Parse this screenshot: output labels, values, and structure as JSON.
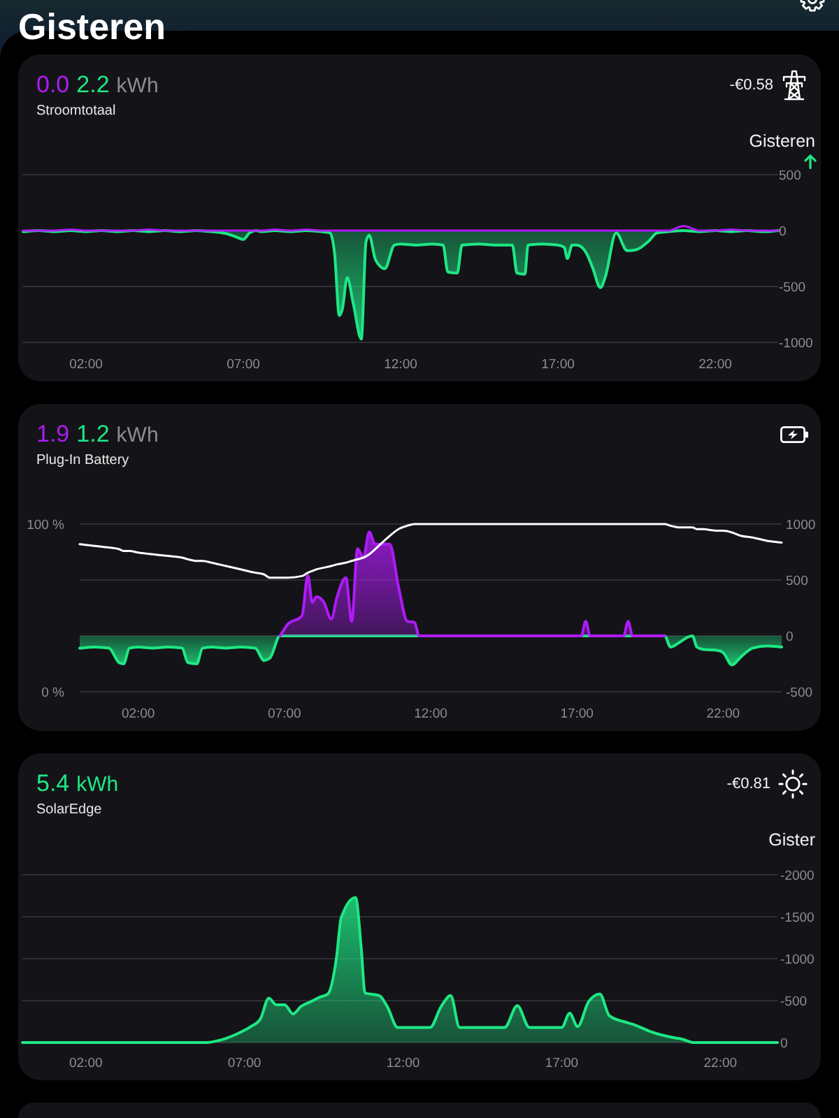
{
  "header": {
    "title": "Gisteren"
  },
  "cards": [
    {
      "kind": "grid",
      "readings": [
        {
          "value": "0.0",
          "color": "#ae1bf5"
        },
        {
          "value": "2.2",
          "color": "#1ee884"
        }
      ],
      "unit": "kWh",
      "name": "Stroomtotaal",
      "price": "-€0.58",
      "period": "Gisteren",
      "trend_up": true,
      "chart_data": {
        "type": "area",
        "grid": true,
        "x": [
          0,
          0.5,
          1,
          1.5,
          2,
          2.5,
          3,
          3.5,
          4,
          4.5,
          5,
          5.5,
          6,
          6.5,
          6.8,
          7,
          7.2,
          7.4,
          7.6,
          8,
          8.5,
          9,
          9.5,
          9.75,
          9.9,
          10.05,
          10.15,
          10.3,
          10.5,
          10.75,
          10.9,
          11,
          11.2,
          11.5,
          11.8,
          12,
          12.5,
          13,
          13.35,
          13.5,
          13.8,
          13.95,
          14.5,
          15,
          15.55,
          15.7,
          15.95,
          16.05,
          16.5,
          17,
          17.2,
          17.3,
          17.45,
          17.6,
          17.9,
          18.1,
          18.35,
          18.5,
          18.85,
          19.2,
          19.5,
          19.9,
          20.15,
          20.5,
          21,
          21.5,
          22,
          22.5,
          23,
          23.5,
          24
        ],
        "xlim": [
          0,
          24
        ],
        "xticks": [
          {
            "value": 2,
            "label": "02:00"
          },
          {
            "value": 7,
            "label": "07:00"
          },
          {
            "value": 12,
            "label": "12:00"
          },
          {
            "value": 17,
            "label": "17:00"
          },
          {
            "value": 22,
            "label": "22:00"
          }
        ],
        "ylim": [
          -1000,
          500
        ],
        "yticks": [
          500,
          0,
          -500,
          -1000
        ],
        "series": [
          {
            "color": "#1ee884",
            "values": [
              -10,
              0,
              -10,
              0,
              -10,
              0,
              -10,
              0,
              -10,
              0,
              -10,
              0,
              -10,
              -30,
              -60,
              -80,
              -20,
              0,
              -10,
              0,
              -10,
              0,
              -10,
              -20,
              -200,
              -760,
              -700,
              -420,
              -660,
              -970,
              -100,
              -40,
              -260,
              -340,
              -130,
              -120,
              -130,
              -120,
              -130,
              -370,
              -380,
              -130,
              -120,
              -130,
              -130,
              -380,
              -390,
              -130,
              -120,
              -130,
              -150,
              -250,
              -130,
              -130,
              -200,
              -330,
              -510,
              -420,
              -20,
              -180,
              -170,
              -90,
              -20,
              -10,
              0,
              -10,
              0,
              -10,
              0,
              -10,
              0
            ]
          },
          {
            "type": "line",
            "color": "#ae1bf5",
            "values": [
              0,
              0,
              0,
              10,
              0,
              0,
              0,
              0,
              10,
              0,
              0,
              0,
              0,
              0,
              0,
              0,
              0,
              0,
              0,
              10,
              0,
              10,
              0,
              0,
              0,
              0,
              0,
              0,
              0,
              0,
              0,
              0,
              0,
              0,
              0,
              0,
              0,
              0,
              0,
              0,
              0,
              0,
              0,
              0,
              0,
              0,
              0,
              0,
              0,
              0,
              0,
              0,
              0,
              0,
              0,
              0,
              0,
              0,
              0,
              0,
              0,
              0,
              0,
              0,
              40,
              0,
              0,
              10,
              0,
              0,
              0
            ]
          }
        ]
      }
    },
    {
      "kind": "battery",
      "readings": [
        {
          "value": "1.9",
          "color": "#ae1bf5"
        },
        {
          "value": "1.2",
          "color": "#1ee884"
        }
      ],
      "unit": "kWh",
      "name": "Plug-In Battery",
      "chart_data": {
        "type": "area",
        "grid": true,
        "x": [
          0,
          0.5,
          1,
          1.35,
          1.5,
          1.7,
          2,
          2.5,
          3,
          3.5,
          3.7,
          4,
          4.2,
          4.5,
          5,
          5.5,
          6,
          6.3,
          6.5,
          6.85,
          7.1,
          7.6,
          7.8,
          7.95,
          8.1,
          8.35,
          8.6,
          8.8,
          9.1,
          9.3,
          9.5,
          9.7,
          9.9,
          10.1,
          10.6,
          10.9,
          11.2,
          11.45,
          11.6,
          12,
          13,
          14,
          15,
          16,
          17,
          17.15,
          17.3,
          17.45,
          18,
          18.6,
          18.75,
          18.9,
          19.5,
          20,
          20.2,
          20.5,
          20.8,
          20.95,
          21.1,
          21.3,
          21.8,
          22,
          22.3,
          22.6,
          23,
          23.5,
          24
        ],
        "xlim": [
          0,
          24
        ],
        "xticks": [
          {
            "value": 2,
            "label": "02:00"
          },
          {
            "value": 7,
            "label": "07:00"
          },
          {
            "value": 12,
            "label": "12:00"
          },
          {
            "value": 17,
            "label": "17:00"
          },
          {
            "value": 22,
            "label": "22:00"
          }
        ],
        "ylim": [
          -500,
          1000
        ],
        "yticks": [
          1000,
          500,
          0,
          -500
        ],
        "y2lim": [
          0,
          100
        ],
        "y2ticks": [
          {
            "value": 100,
            "label": "100 %"
          },
          {
            "value": 0,
            "label": "0 %"
          }
        ],
        "series": [
          {
            "color": "#1ee884",
            "values": [
              -110,
              -100,
              -110,
              -240,
              -250,
              -110,
              -100,
              -110,
              -100,
              -110,
              -240,
              -250,
              -110,
              -100,
              -110,
              -100,
              -110,
              -220,
              -200,
              0,
              0,
              0,
              0,
              0,
              0,
              0,
              0,
              0,
              0,
              0,
              0,
              0,
              0,
              0,
              0,
              0,
              0,
              0,
              0,
              0,
              0,
              0,
              0,
              0,
              0,
              0,
              0,
              0,
              0,
              0,
              0,
              0,
              0,
              0,
              -100,
              -60,
              -10,
              0,
              -100,
              -120,
              -130,
              -150,
              -260,
              -190,
              -110,
              -90,
              -100
            ]
          },
          {
            "color": "#ae1bf5",
            "values": [
              null,
              null,
              null,
              null,
              null,
              null,
              null,
              null,
              null,
              null,
              null,
              null,
              null,
              null,
              null,
              null,
              null,
              null,
              null,
              0,
              100,
              180,
              540,
              300,
              350,
              300,
              150,
              350,
              520,
              130,
              780,
              700,
              930,
              820,
              820,
              440,
              130,
              120,
              0,
              0,
              0,
              0,
              0,
              0,
              0,
              0,
              130,
              0,
              0,
              0,
              130,
              0,
              0,
              0,
              null,
              null,
              null,
              null,
              null,
              null,
              null,
              null,
              null,
              null,
              null,
              null,
              null
            ]
          },
          {
            "type": "line",
            "axis": "y2",
            "color": "#ffffff",
            "values": [
              88,
              87,
              86,
              85,
              84,
              84,
              83,
              82,
              81,
              80,
              79,
              78,
              78,
              77,
              75,
              73,
              71,
              70,
              68,
              68,
              68,
              69,
              71,
              72,
              73,
              74,
              75,
              76,
              77,
              78,
              79,
              80,
              82,
              85,
              93,
              97,
              99,
              100,
              100,
              100,
              100,
              100,
              100,
              100,
              100,
              100,
              100,
              100,
              100,
              100,
              100,
              100,
              100,
              100,
              99,
              98,
              98,
              98,
              97,
              97,
              96,
              96,
              95,
              93,
              92,
              90,
              89
            ]
          }
        ]
      }
    },
    {
      "kind": "solar",
      "readings": [
        {
          "value": "5.4",
          "color": "#1ee884"
        }
      ],
      "unit": "kWh",
      "name": "SolarEdge",
      "price": "-€0.81",
      "period": "Gister",
      "chart_data": {
        "type": "area",
        "grid": true,
        "x": [
          0,
          1,
          2,
          3,
          4,
          5,
          5.8,
          6.25,
          6.75,
          7.2,
          7.5,
          7.77,
          8,
          8.27,
          8.53,
          8.78,
          9.1,
          9.37,
          9.63,
          9.9,
          10.05,
          10.5,
          10.68,
          10.8,
          11.25,
          11.5,
          11.83,
          12.85,
          13.2,
          13.5,
          13.78,
          15.2,
          15.6,
          15.98,
          17,
          17.25,
          17.5,
          17.85,
          18.2,
          18.5,
          18.95,
          19.3,
          19.8,
          20.5,
          20.8,
          21.15,
          22,
          23,
          23.8
        ],
        "xlim": [
          0,
          23.8
        ],
        "xticks": [
          {
            "value": 2,
            "label": "02:00"
          },
          {
            "value": 7,
            "label": "07:00"
          },
          {
            "value": 12,
            "label": "12:00"
          },
          {
            "value": 17,
            "label": "17:00"
          },
          {
            "value": 22,
            "label": "22:00"
          }
        ],
        "ylim": [
          0,
          -2000
        ],
        "yticks": [
          0,
          -500,
          -1000,
          -1500,
          -2000
        ],
        "series": [
          {
            "color": "#1ee884",
            "values": [
              0,
              0,
              0,
              0,
              0,
              0,
              0,
              -30,
              -100,
              -190,
              -280,
              -530,
              -450,
              -450,
              -340,
              -430,
              -490,
              -540,
              -580,
              -1010,
              -1490,
              -1730,
              -1130,
              -590,
              -560,
              -430,
              -180,
              -180,
              -430,
              -560,
              -180,
              -180,
              -440,
              -180,
              -180,
              -350,
              -190,
              -490,
              -580,
              -320,
              -250,
              -210,
              -130,
              -60,
              -40,
              0,
              0,
              0,
              0
            ]
          }
        ]
      }
    },
    {
      "kind": "partial"
    }
  ]
}
